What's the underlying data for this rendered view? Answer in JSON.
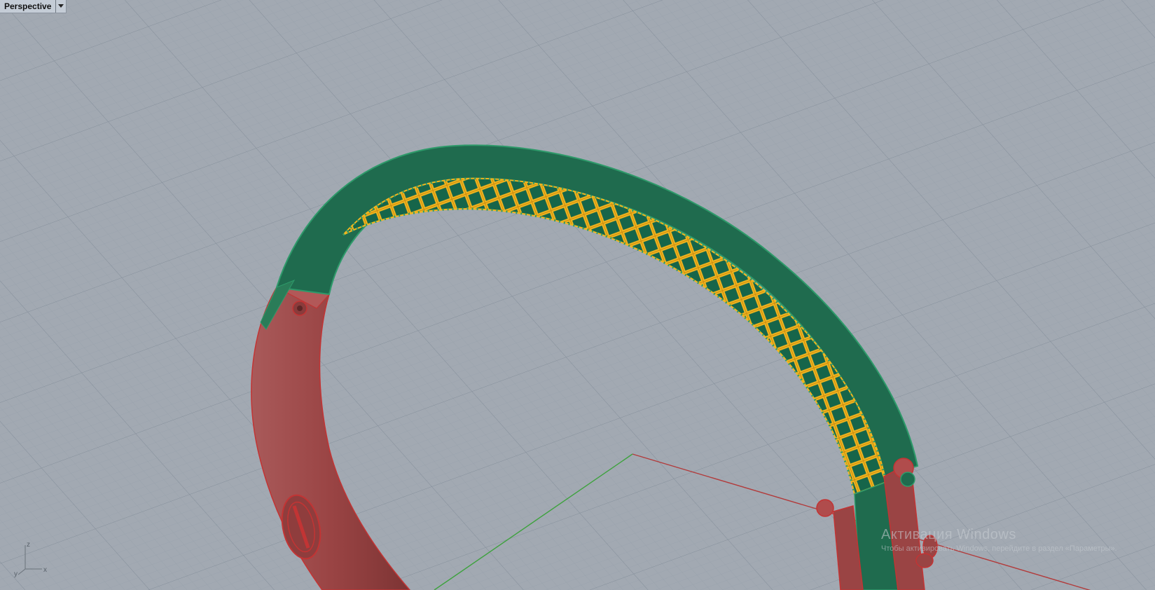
{
  "viewport": {
    "title": "Perspective",
    "menu_icon": "dropdown-triangle-icon"
  },
  "axes_widget": {
    "x_label": "x",
    "y_label": "y",
    "z_label": "z"
  },
  "watermark": {
    "line1": "Активация Windows",
    "line2": "Чтобы активировать Windows, перейдите в раздел «Параметры»."
  },
  "colors": {
    "background": "#a2a9b2",
    "grid_minor": "#97a0aa",
    "grid_major": "#8a939e",
    "world_x_axis": "#b23b3b",
    "world_y_axis": "#3ea23e",
    "selected_red": "#9e4444",
    "locked_green": "#1f6b4e",
    "lattice_yellow": "#f2b61e"
  }
}
